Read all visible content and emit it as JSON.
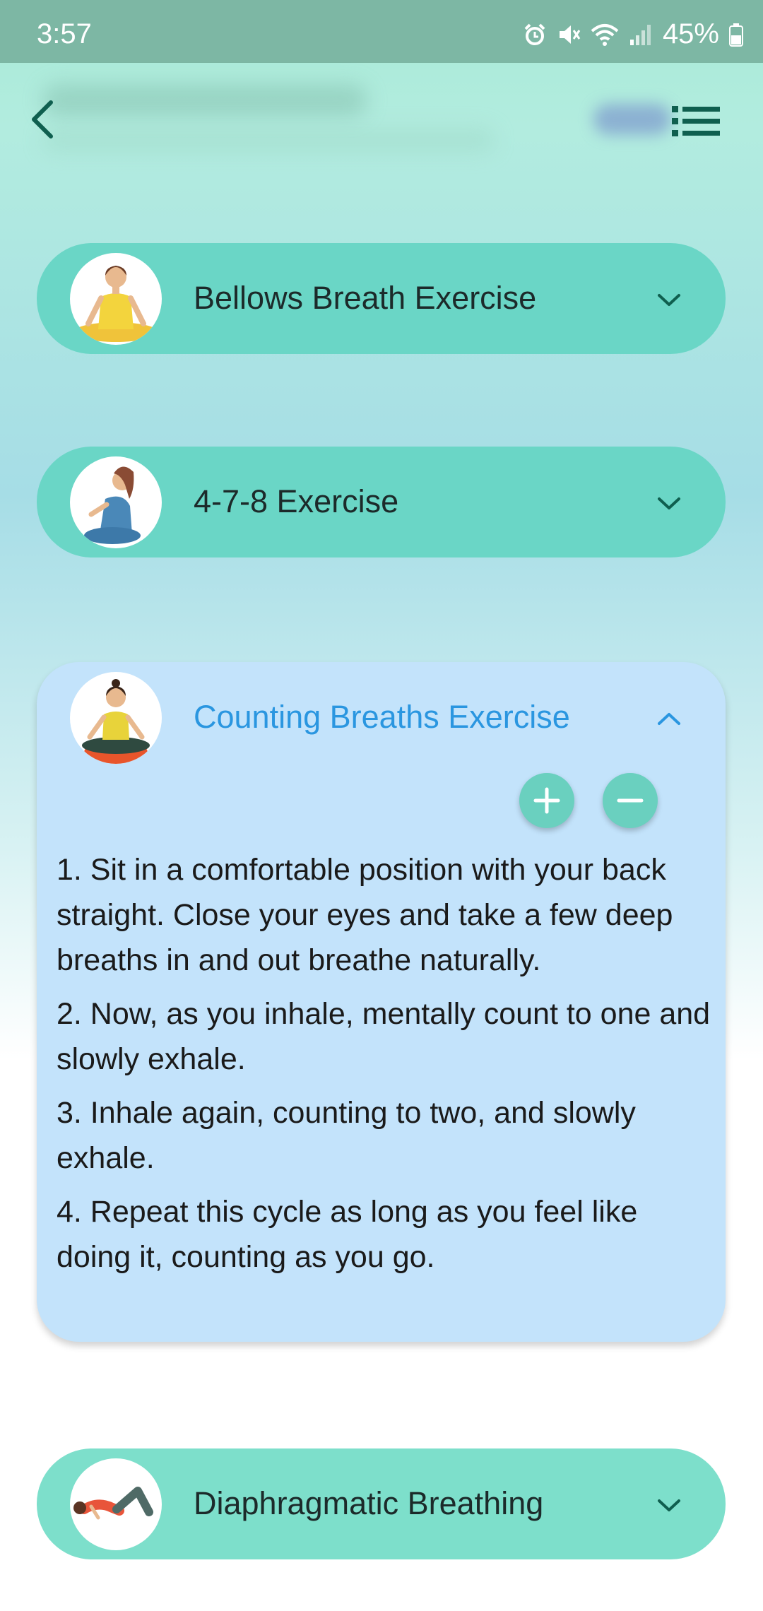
{
  "status_bar": {
    "time": "3:57",
    "battery": "45%"
  },
  "exercises": [
    {
      "title": "Bellows Breath Exercise",
      "expanded": false
    },
    {
      "title": "4-7-8 Exercise",
      "expanded": false
    },
    {
      "title": "Counting Breaths Exercise",
      "expanded": true,
      "steps": [
        "1. Sit in a comfortable position with your back straight. Close your eyes and take a few deep breaths in and out breathe naturally.",
        "2. Now, as you inhale, mentally count to one and slowly exhale.",
        "3. Inhale again, counting to two, and slowly exhale.",
        "4. Repeat this cycle as long as you feel like doing it, counting as you go."
      ]
    },
    {
      "title": "Diaphragmatic Breathing",
      "expanded": false
    }
  ],
  "colors": {
    "accent_teal": "#6ad6c6",
    "expanded_card": "#c3e3fb",
    "expanded_title": "#2a96e0",
    "status_bar": "#7db7a4",
    "icon_dark_teal": "#0f5f4f"
  },
  "icons": {
    "back": "chevron-left-icon",
    "menu": "list-icon",
    "expand": "chevron-down-icon",
    "collapse": "chevron-up-icon",
    "zoom_in": "plus-icon",
    "zoom_out": "minus-icon"
  }
}
